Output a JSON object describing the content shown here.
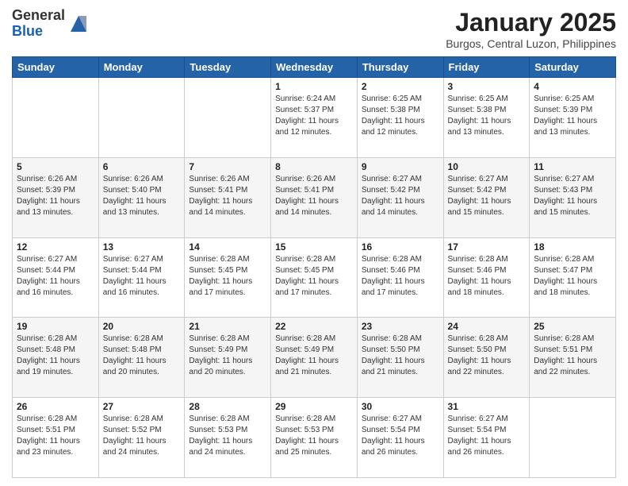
{
  "logo": {
    "general": "General",
    "blue": "Blue"
  },
  "header": {
    "month": "January 2025",
    "location": "Burgos, Central Luzon, Philippines"
  },
  "days_of_week": [
    "Sunday",
    "Monday",
    "Tuesday",
    "Wednesday",
    "Thursday",
    "Friday",
    "Saturday"
  ],
  "weeks": [
    [
      {
        "day": "",
        "info": ""
      },
      {
        "day": "",
        "info": ""
      },
      {
        "day": "",
        "info": ""
      },
      {
        "day": "1",
        "info": "Sunrise: 6:24 AM\nSunset: 5:37 PM\nDaylight: 11 hours and 12 minutes."
      },
      {
        "day": "2",
        "info": "Sunrise: 6:25 AM\nSunset: 5:38 PM\nDaylight: 11 hours and 12 minutes."
      },
      {
        "day": "3",
        "info": "Sunrise: 6:25 AM\nSunset: 5:38 PM\nDaylight: 11 hours and 13 minutes."
      },
      {
        "day": "4",
        "info": "Sunrise: 6:25 AM\nSunset: 5:39 PM\nDaylight: 11 hours and 13 minutes."
      }
    ],
    [
      {
        "day": "5",
        "info": "Sunrise: 6:26 AM\nSunset: 5:39 PM\nDaylight: 11 hours and 13 minutes."
      },
      {
        "day": "6",
        "info": "Sunrise: 6:26 AM\nSunset: 5:40 PM\nDaylight: 11 hours and 13 minutes."
      },
      {
        "day": "7",
        "info": "Sunrise: 6:26 AM\nSunset: 5:41 PM\nDaylight: 11 hours and 14 minutes."
      },
      {
        "day": "8",
        "info": "Sunrise: 6:26 AM\nSunset: 5:41 PM\nDaylight: 11 hours and 14 minutes."
      },
      {
        "day": "9",
        "info": "Sunrise: 6:27 AM\nSunset: 5:42 PM\nDaylight: 11 hours and 14 minutes."
      },
      {
        "day": "10",
        "info": "Sunrise: 6:27 AM\nSunset: 5:42 PM\nDaylight: 11 hours and 15 minutes."
      },
      {
        "day": "11",
        "info": "Sunrise: 6:27 AM\nSunset: 5:43 PM\nDaylight: 11 hours and 15 minutes."
      }
    ],
    [
      {
        "day": "12",
        "info": "Sunrise: 6:27 AM\nSunset: 5:44 PM\nDaylight: 11 hours and 16 minutes."
      },
      {
        "day": "13",
        "info": "Sunrise: 6:27 AM\nSunset: 5:44 PM\nDaylight: 11 hours and 16 minutes."
      },
      {
        "day": "14",
        "info": "Sunrise: 6:28 AM\nSunset: 5:45 PM\nDaylight: 11 hours and 17 minutes."
      },
      {
        "day": "15",
        "info": "Sunrise: 6:28 AM\nSunset: 5:45 PM\nDaylight: 11 hours and 17 minutes."
      },
      {
        "day": "16",
        "info": "Sunrise: 6:28 AM\nSunset: 5:46 PM\nDaylight: 11 hours and 17 minutes."
      },
      {
        "day": "17",
        "info": "Sunrise: 6:28 AM\nSunset: 5:46 PM\nDaylight: 11 hours and 18 minutes."
      },
      {
        "day": "18",
        "info": "Sunrise: 6:28 AM\nSunset: 5:47 PM\nDaylight: 11 hours and 18 minutes."
      }
    ],
    [
      {
        "day": "19",
        "info": "Sunrise: 6:28 AM\nSunset: 5:48 PM\nDaylight: 11 hours and 19 minutes."
      },
      {
        "day": "20",
        "info": "Sunrise: 6:28 AM\nSunset: 5:48 PM\nDaylight: 11 hours and 20 minutes."
      },
      {
        "day": "21",
        "info": "Sunrise: 6:28 AM\nSunset: 5:49 PM\nDaylight: 11 hours and 20 minutes."
      },
      {
        "day": "22",
        "info": "Sunrise: 6:28 AM\nSunset: 5:49 PM\nDaylight: 11 hours and 21 minutes."
      },
      {
        "day": "23",
        "info": "Sunrise: 6:28 AM\nSunset: 5:50 PM\nDaylight: 11 hours and 21 minutes."
      },
      {
        "day": "24",
        "info": "Sunrise: 6:28 AM\nSunset: 5:50 PM\nDaylight: 11 hours and 22 minutes."
      },
      {
        "day": "25",
        "info": "Sunrise: 6:28 AM\nSunset: 5:51 PM\nDaylight: 11 hours and 22 minutes."
      }
    ],
    [
      {
        "day": "26",
        "info": "Sunrise: 6:28 AM\nSunset: 5:51 PM\nDaylight: 11 hours and 23 minutes."
      },
      {
        "day": "27",
        "info": "Sunrise: 6:28 AM\nSunset: 5:52 PM\nDaylight: 11 hours and 24 minutes."
      },
      {
        "day": "28",
        "info": "Sunrise: 6:28 AM\nSunset: 5:53 PM\nDaylight: 11 hours and 24 minutes."
      },
      {
        "day": "29",
        "info": "Sunrise: 6:28 AM\nSunset: 5:53 PM\nDaylight: 11 hours and 25 minutes."
      },
      {
        "day": "30",
        "info": "Sunrise: 6:27 AM\nSunset: 5:54 PM\nDaylight: 11 hours and 26 minutes."
      },
      {
        "day": "31",
        "info": "Sunrise: 6:27 AM\nSunset: 5:54 PM\nDaylight: 11 hours and 26 minutes."
      },
      {
        "day": "",
        "info": ""
      }
    ]
  ]
}
